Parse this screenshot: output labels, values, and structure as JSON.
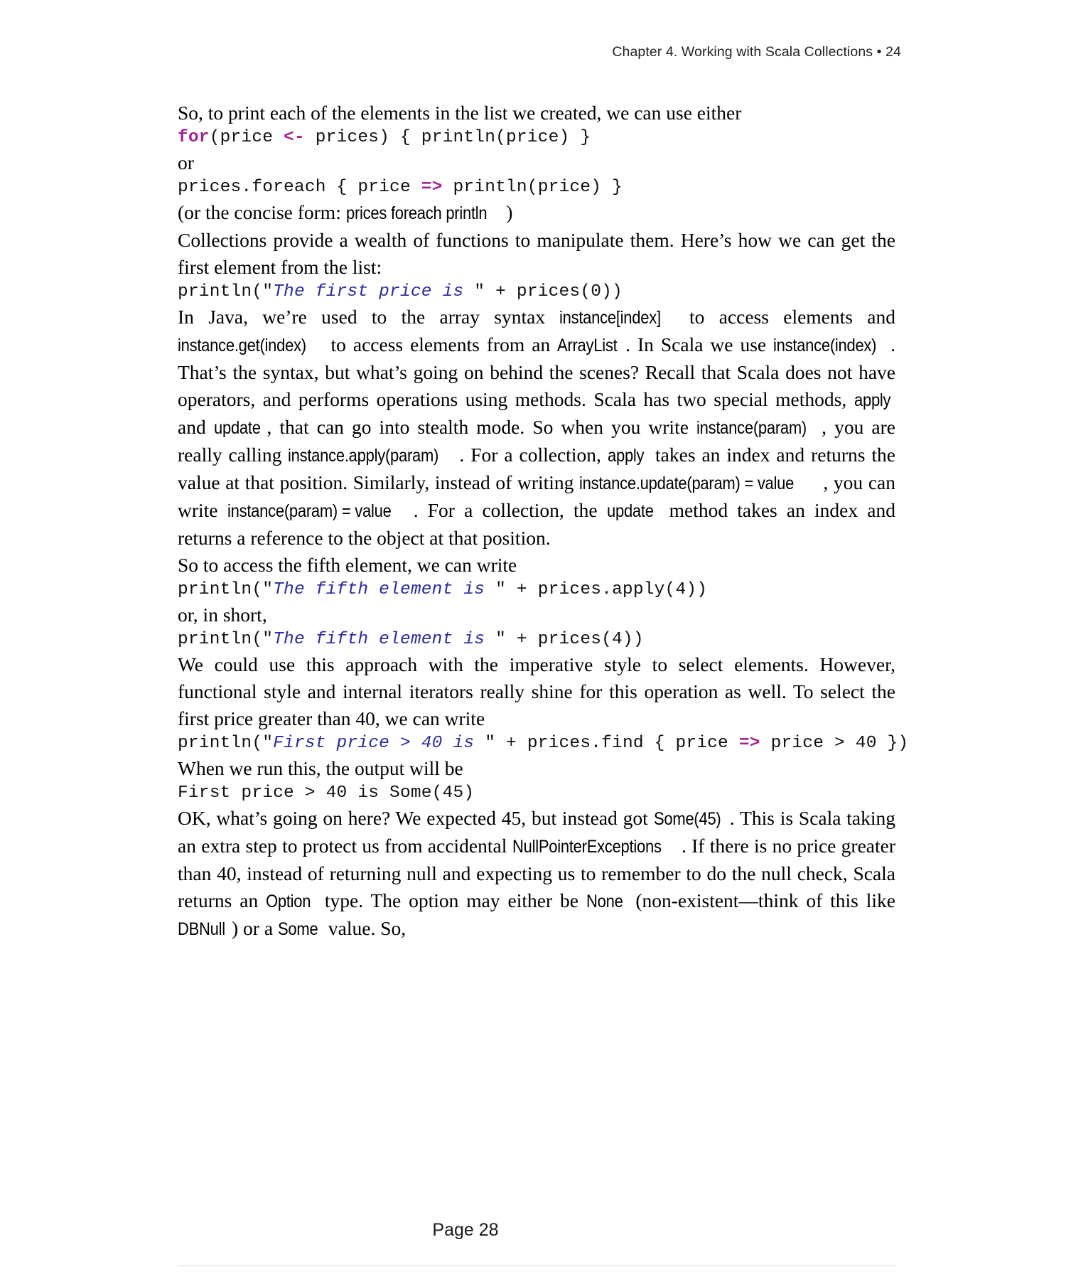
{
  "header": {
    "running_head": "Chapter 4. Working with Scala Collections • 24"
  },
  "footer": {
    "page_label": "Page 28"
  },
  "colors": {
    "keyword": "#a0268f",
    "operator": "#a0268f",
    "string": "#2b2b9e",
    "body_text": "#000000",
    "rule": "#d9dde0"
  },
  "blocks": {
    "p1": "So, to print each of the elements in the list we created, we can use either",
    "code1": {
      "seg1": "for",
      "seg2": "(price ",
      "seg3": "<-",
      "seg4": " prices) { println(price) }"
    },
    "p2": "or",
    "code2": {
      "seg1": "prices.foreach { price ",
      "seg2": "=>",
      "seg3": " println(price) }"
    },
    "p3": {
      "t1": "(or the concise form: ",
      "c1": "prices foreach println",
      "t2": ")"
    },
    "p4": "Collections provide a wealth of functions to manipulate them. Here’s how we can get the first element from the list:",
    "code3": {
      "seg1": "println(",
      "q1": "\"",
      "str1": "The first price is ",
      "q2": "\"",
      "seg2": " + prices(0))"
    },
    "p5": {
      "t1": "In Java, we’re used to the array syntax ",
      "c1": "instance[index]",
      "t2": " to access elements and ",
      "c2": "instance.get(index)",
      "t3": " to access elements from an ",
      "c3": "ArrayList",
      "t4": ". In Scala we use ",
      "c4": "instance(index)",
      "t5": ". That’s the syntax, but what’s going on behind the scenes? Recall that Scala does not have operators, and performs operations using methods. Scala has two special methods, ",
      "c5": "apply",
      "t6": " and ",
      "c6": "update",
      "t7": ", that can go into stealth mode. So when you write ",
      "c7": "instance(param)",
      "t8": ", you are really calling ",
      "c8": "instance.apply(param)",
      "t9": ". For a collection, ",
      "c9": "apply",
      "t10": " takes an index and returns the value at that position. Similarly, instead of writing ",
      "c10": "instance.update(param) = value",
      "t11": ", you can write ",
      "c11": "instance(param) = value",
      "t12": ". For a collection, the ",
      "c12": "update",
      "t13": " method takes an index and returns a reference to the object at that position."
    },
    "p6": "So to access the fifth element, we can write",
    "code4": {
      "seg1": "println(",
      "q1": "\"",
      "str1": "The fifth element is ",
      "q2": "\"",
      "seg2": " + prices.apply(4))"
    },
    "p7": "or, in short,",
    "code5": {
      "seg1": "println(",
      "q1": "\"",
      "str1": "The fifth element is ",
      "q2": "\"",
      "seg2": " + prices(4))"
    },
    "p8": "We could use this approach with the imperative style to select elements. However, functional style and internal iterators really shine for this operation as well. To select the first price greater than 40, we can write",
    "code6": {
      "seg1": "println(",
      "q1": "\"",
      "str1": "First price > 40 is ",
      "q2": "\"",
      "seg2": " + prices.find { price ",
      "seg3": "=>",
      "seg4": " price > 40 })"
    },
    "p9": "When we run this, the output will be",
    "code7": {
      "seg1": "First price > 40 is Some(45)"
    },
    "p10": {
      "t1": "OK, what’s going on here? We expected 45, but instead got ",
      "c1": "Some(45)",
      "t2": ". This is Scala taking an extra step to protect us from accidental ",
      "c2": "NullPointerExceptions",
      "t3": ". If there is no price greater than 40, instead of returning null and expecting us to remember to do the null check, Scala returns an ",
      "c3": "Option",
      "t4": " type. The option may either be ",
      "c4": "None",
      "t5": " (non-existent—think of this like ",
      "c5": "DBNull",
      "t6": ") or a ",
      "c6": "Some",
      "t7": " value. So,"
    }
  }
}
